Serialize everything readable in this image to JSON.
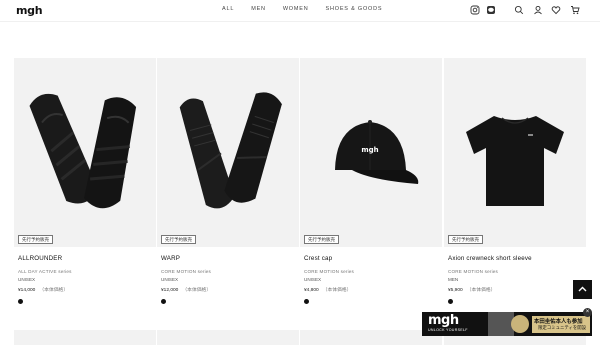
{
  "header": {
    "logo": "mgh",
    "nav": [
      "ALL",
      "MEN",
      "WOMEN",
      "SHOES & GOODS"
    ],
    "icons": [
      "instagram-icon",
      "line-icon",
      "search-icon",
      "account-icon",
      "heart-icon",
      "cart-icon"
    ]
  },
  "products": [
    {
      "badge": "先行予約販売",
      "name": "ALLROUNDER",
      "series": "ALL DAY ACTIVE series",
      "category": "UNISEX",
      "price": "¥14,000",
      "tax": "（本体価格）",
      "image": "black sneaker pair"
    },
    {
      "badge": "先行予約販売",
      "name": "WARP",
      "series": "CORE MOTION series",
      "category": "UNISEX",
      "price": "¥12,000",
      "tax": "（本体価格）",
      "image": "black knit sneaker pair"
    },
    {
      "badge": "先行予約販売",
      "name": "Crest cap",
      "series": "CORE MOTION series",
      "category": "UNISEX",
      "price": "¥4,800",
      "tax": "（本体価格）",
      "image": "black cap",
      "cap_logo": "mgh"
    },
    {
      "badge": "先行予約販売",
      "name": "Axion crewneck short sleeve",
      "series": "CORE MOTION series",
      "category": "MEN",
      "price": "¥5,900",
      "tax": "（本体価格）",
      "image": "black t-shirt"
    }
  ],
  "banner": {
    "logo": "mgh",
    "tagline": "UNLOCK YOURSELF",
    "line1": "本田圭佑本人も参加",
    "line2": "限定コミュニティを開設",
    "close": "×"
  },
  "colors": {
    "image_bg": "#f2f2f2",
    "banner_bg": "#111111",
    "banner_gold": "#d8c48a"
  }
}
